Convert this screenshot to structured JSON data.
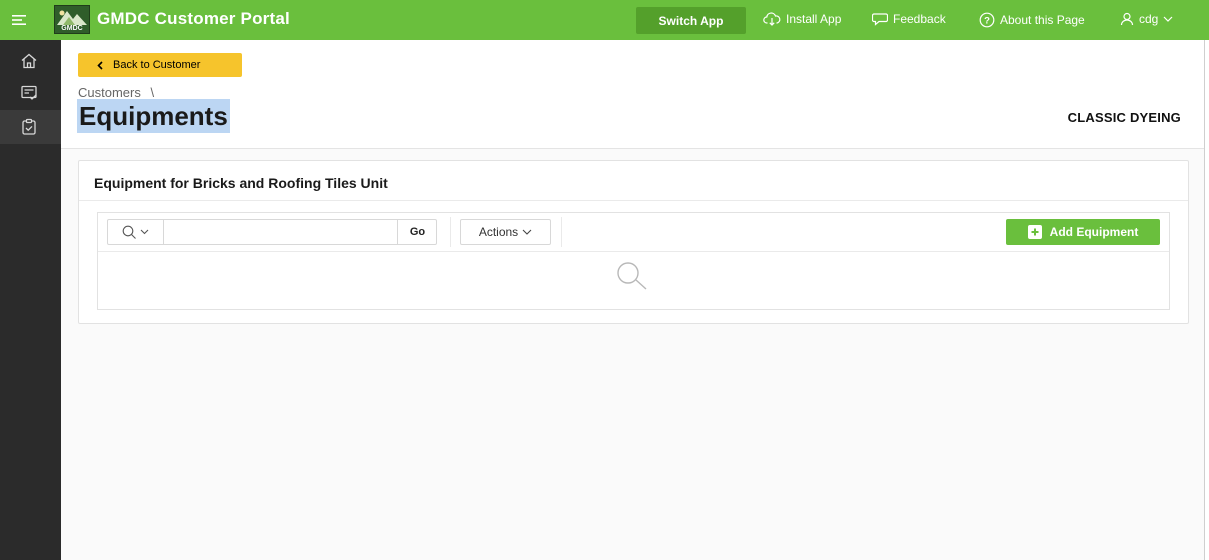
{
  "app": {
    "title": "GMDC Customer Portal",
    "logo_text": "GMDC",
    "switch_app_label": "Switch App",
    "install_app_label": "Install App",
    "feedback_label": "Feedback",
    "about_label": "About this Page",
    "user_label": "cdg"
  },
  "sidebar": {
    "items": [
      {
        "icon": "home-icon"
      },
      {
        "icon": "checklist-icon"
      },
      {
        "icon": "clipboard-check-icon"
      }
    ]
  },
  "page": {
    "back_label": "Back to Customer",
    "breadcrumb": "Customers",
    "breadcrumb_separator": "\\",
    "title": "Equipments",
    "customer_name": "CLASSIC DYEING"
  },
  "region": {
    "title": "Equipment for Bricks and Roofing Tiles Unit",
    "search": {
      "value": "",
      "placeholder": ""
    },
    "go_label": "Go",
    "actions_label": "Actions",
    "add_label": "Add Equipment"
  },
  "colors": {
    "header_green": "#6abf3d",
    "back_yellow": "#f6c42c",
    "sidebar_dark": "#2b2b2b"
  }
}
